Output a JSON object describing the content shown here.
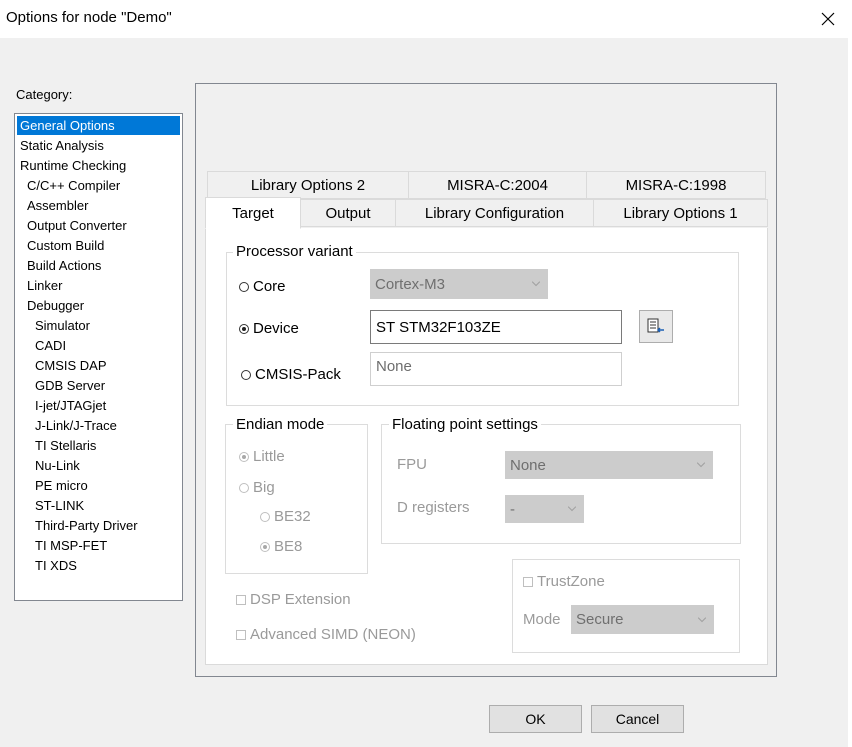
{
  "window": {
    "title": "Options for node \"Demo\""
  },
  "category": {
    "label": "Category:",
    "items": [
      {
        "label": "General Options"
      },
      {
        "label": "Static Analysis"
      },
      {
        "label": "Runtime Checking"
      },
      {
        "label": "C/C++ Compiler"
      },
      {
        "label": "Assembler"
      },
      {
        "label": "Output Converter"
      },
      {
        "label": "Custom Build"
      },
      {
        "label": "Build Actions"
      },
      {
        "label": "Linker"
      },
      {
        "label": "Debugger"
      },
      {
        "label": "Simulator"
      },
      {
        "label": "CADI"
      },
      {
        "label": "CMSIS DAP"
      },
      {
        "label": "GDB Server"
      },
      {
        "label": "I-jet/JTAGjet"
      },
      {
        "label": "J-Link/J-Trace"
      },
      {
        "label": "TI Stellaris"
      },
      {
        "label": "Nu-Link"
      },
      {
        "label": "PE micro"
      },
      {
        "label": "ST-LINK"
      },
      {
        "label": "Third-Party Driver"
      },
      {
        "label": "TI MSP-FET"
      },
      {
        "label": "TI XDS"
      }
    ]
  },
  "tabs": {
    "row_back": [
      "Library Options 2",
      "MISRA-C:2004",
      "MISRA-C:1998"
    ],
    "row_front": [
      "Target",
      "Output",
      "Library Configuration",
      "Library Options 1"
    ]
  },
  "processor": {
    "title": "Processor variant",
    "core_label": "Core",
    "core_value": "Cortex-M3",
    "device_label": "Device",
    "device_value": "ST STM32F103ZE",
    "cmsis_label": "CMSIS-Pack",
    "cmsis_value": "None"
  },
  "endian": {
    "title": "Endian mode",
    "little": "Little",
    "big": "Big",
    "be32": "BE32",
    "be8": "BE8"
  },
  "fp": {
    "title": "Floating point settings",
    "fpu_label": "FPU",
    "fpu_value": "None",
    "dreg_label": "D registers",
    "dreg_value": "-"
  },
  "trustzone": {
    "label": "TrustZone",
    "mode_label": "Mode",
    "mode_value": "Secure"
  },
  "options": {
    "dsp": "DSP Extension",
    "simd": "Advanced SIMD (NEON)"
  },
  "buttons": {
    "ok": "OK",
    "cancel": "Cancel"
  }
}
